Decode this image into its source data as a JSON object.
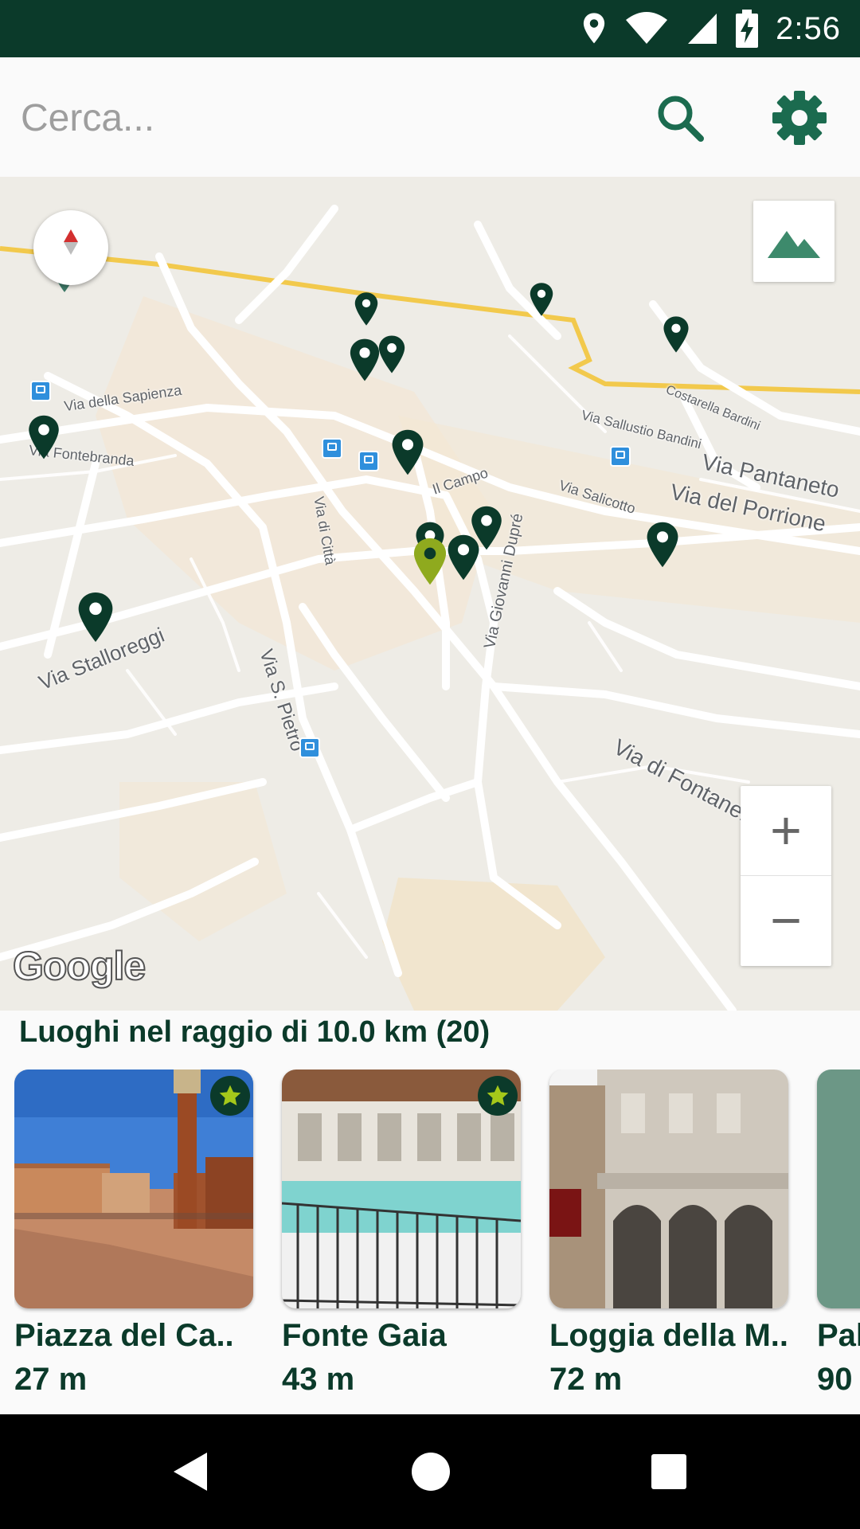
{
  "status_bar": {
    "time": "2:56",
    "icons": [
      "location-icon",
      "wifi-icon",
      "signal-icon",
      "battery-charging-icon"
    ],
    "background": "#0b3a2a"
  },
  "search": {
    "placeholder": "Cerca...",
    "value": "",
    "search_icon": "search-icon",
    "settings_icon": "gear-icon",
    "accent": "#1b6b4f"
  },
  "map": {
    "streets": [
      "Via della Sapienza",
      "Via Fontebranda",
      "Via di Città",
      "Il Campo",
      "Via Salicotto",
      "Via Pantaneto",
      "Via del Porrione",
      "Via Sallustio Bandini",
      "Costarella Bardini",
      "Via Giovanni Dupré",
      "Via Stalloreggi",
      "Via S. Pietro",
      "Via di Fontanella"
    ],
    "zoom_in_label": "+",
    "zoom_out_label": "−",
    "attribution": "Google",
    "marker_color": "#0b3a2a",
    "selected_marker_color": "#8faa1e"
  },
  "nearby": {
    "title": "Luoghi nel raggio di 10.0 km (20)",
    "places": [
      {
        "name": "Piazza del Ca..",
        "distance": "27 m",
        "starred": true
      },
      {
        "name": "Fonte Gaia",
        "distance": "43 m",
        "starred": true
      },
      {
        "name": "Loggia della M..",
        "distance": "72 m",
        "starred": false
      },
      {
        "name": "Pal",
        "distance": "90",
        "starred": false
      }
    ]
  },
  "nav_bar": {
    "buttons": [
      "back-icon",
      "home-icon",
      "recents-icon"
    ]
  }
}
